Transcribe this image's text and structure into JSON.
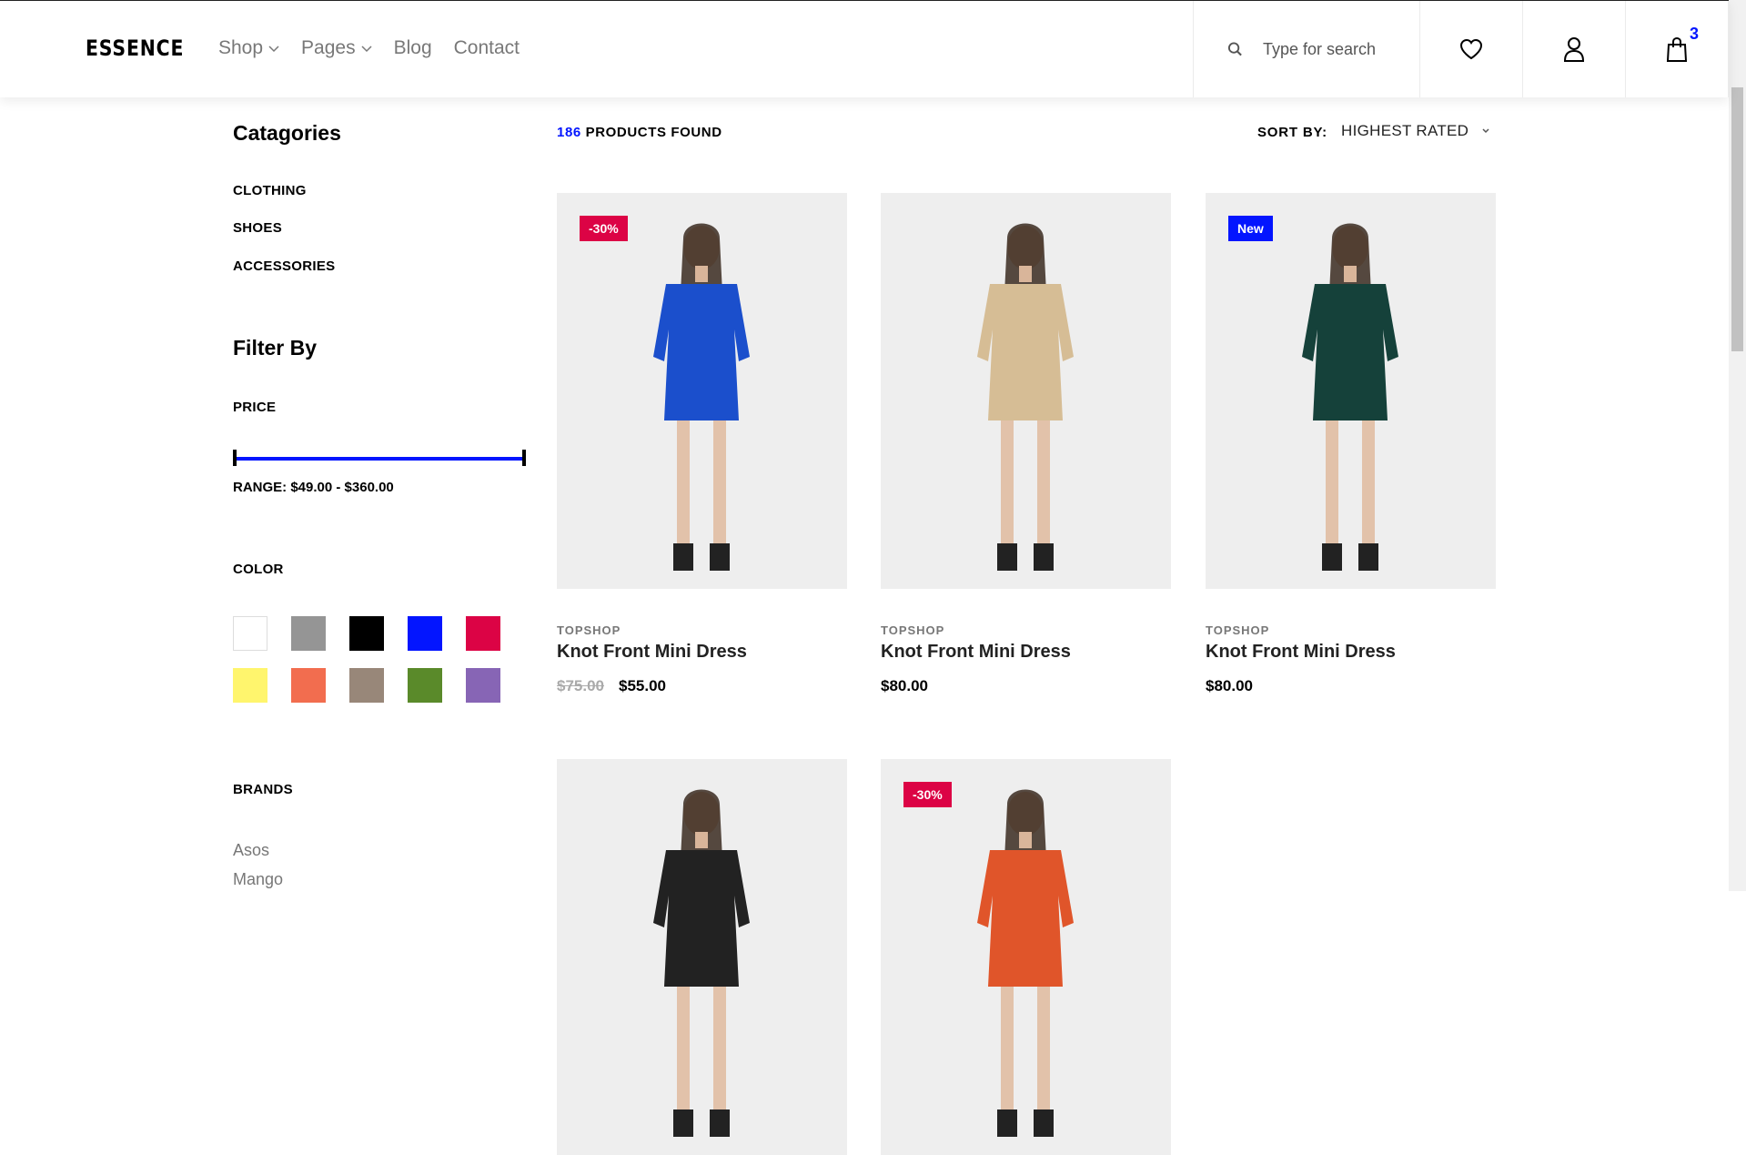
{
  "header": {
    "logo": "ESSENCE",
    "nav": [
      "Shop",
      "Pages",
      "Blog",
      "Contact"
    ],
    "search_placeholder": "Type for search",
    "cart_count": "3"
  },
  "sidebar": {
    "categories_title": "Catagories",
    "categories": [
      "CLOTHING",
      "SHOES",
      "ACCESSORIES"
    ],
    "filter_title": "Filter By",
    "price_label": "PRICE",
    "price_range": "RANGE: $49.00 - $360.00",
    "color_label": "COLOR",
    "colors": [
      "#ffffff",
      "#959595",
      "#000000",
      "#0315ff",
      "#dc0345",
      "#fff56d",
      "#f26d4f",
      "#988779",
      "#5a8a2a",
      "#8765b5"
    ],
    "brands_label": "BRANDS",
    "brands": [
      "Asos",
      "Mango"
    ]
  },
  "main": {
    "found_count": "186",
    "found_text": "PRODUCTS FOUND",
    "sort_label": "SORT BY:",
    "sort_value": "HIGHEST RATED"
  },
  "products": [
    {
      "brand": "TOPSHOP",
      "name": "Knot Front Mini Dress",
      "old_price": "$75.00",
      "price": "$55.00",
      "badge": "-30%",
      "badge_color": "#dc0345",
      "dress_color": "#1b4fcc"
    },
    {
      "brand": "TOPSHOP",
      "name": "Knot Front Mini Dress",
      "old_price": "",
      "price": "$80.00",
      "badge": "",
      "badge_color": "",
      "dress_color": "#d6bd95"
    },
    {
      "brand": "TOPSHOP",
      "name": "Knot Front Mini Dress",
      "old_price": "",
      "price": "$80.00",
      "badge": "New",
      "badge_color": "#0315ff",
      "dress_color": "#15413a"
    },
    {
      "brand": "",
      "name": "",
      "old_price": "",
      "price": "",
      "badge": "",
      "badge_color": "",
      "dress_color": "#222222"
    },
    {
      "brand": "",
      "name": "",
      "old_price": "",
      "price": "",
      "badge": "-30%",
      "badge_color": "#dc0345",
      "dress_color": "#e0552a"
    }
  ]
}
